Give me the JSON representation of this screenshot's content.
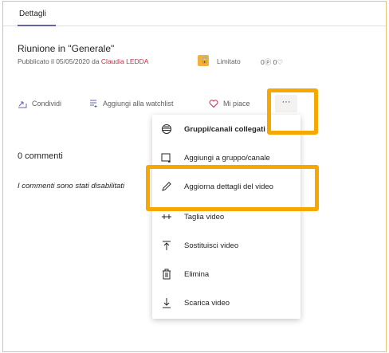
{
  "tabs": {
    "details": "Dettagli"
  },
  "video": {
    "title": "Riunione in \"Generale\"",
    "published_prefix": "Pubblicato il 05/05/2020 da ",
    "author": "Claudia LEDDA",
    "visibility": "Limitato",
    "views": "0",
    "likes": "0"
  },
  "actions": {
    "share": "Condividi",
    "watchlist": "Aggiungi alla watchlist",
    "like": "Mi piace",
    "more": "···"
  },
  "comments": {
    "title": "0 commenti",
    "disabled_note": "I commenti sono stati disabilitati"
  },
  "menu": {
    "items": [
      {
        "label": "Gruppi/canali collegati",
        "icon": "groups-icon"
      },
      {
        "label": "Aggiungi a gruppo/canale",
        "icon": "add-to-group-icon"
      },
      {
        "label": "Aggiorna dettagli del video",
        "icon": "edit-pencil-icon"
      },
      {
        "label": "Taglia video",
        "icon": "trim-icon"
      },
      {
        "label": "Sostituisci video",
        "icon": "upload-replace-icon"
      },
      {
        "label": "Elimina",
        "icon": "trash-icon"
      },
      {
        "label": "Scarica video",
        "icon": "download-icon"
      }
    ]
  },
  "colors": {
    "accent": "#6264a7",
    "highlight": "#f6a800",
    "author_link": "#c4314b",
    "badge": "#f2b13a"
  }
}
